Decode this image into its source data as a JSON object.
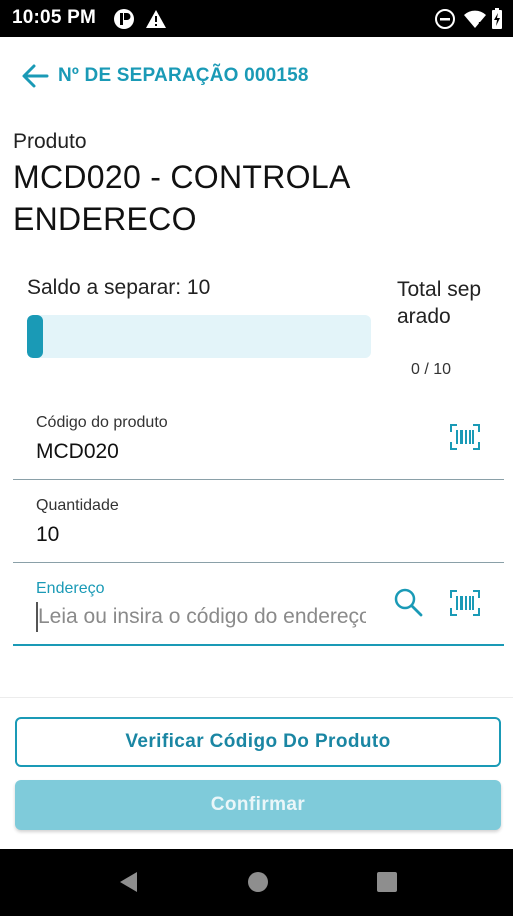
{
  "status_bar": {
    "time": "10:05 PM",
    "icons": [
      "app-notification-icon",
      "warning-icon",
      "do-not-disturb-icon",
      "wifi-icon",
      "battery-icon"
    ]
  },
  "header": {
    "title": "Nº DE SEPARAÇÃO 000158",
    "back_icon": "arrow-left-icon"
  },
  "product": {
    "label": "Produto",
    "name": "MCD020 - CONTROLA ENDERECO"
  },
  "progress": {
    "saldo_text": "Saldo a separar: 10",
    "total_label": "Total separado",
    "total_count": "0 / 10",
    "separated": 0,
    "total": 10
  },
  "fields": {
    "codigo": {
      "label": "Código do produto",
      "value": "MCD020",
      "icon": "barcode-icon"
    },
    "quantidade": {
      "label": "Quantidade",
      "value": "10"
    },
    "endereco": {
      "label": "Endereço",
      "value": "",
      "placeholder": "Leia ou insira o código do endereço",
      "icons": [
        "search-icon",
        "barcode-icon"
      ]
    }
  },
  "actions": {
    "verify_label": "Verificar Código Do Produto",
    "confirm_label": "Confirmar"
  },
  "nav_bar": {
    "icons": [
      "back-triangle-icon",
      "home-circle-icon",
      "recents-square-icon"
    ]
  },
  "colors": {
    "accent": "#1a9ab6",
    "progress_track": "#e3f4f9",
    "confirm_disabled": "#7fcbda"
  }
}
